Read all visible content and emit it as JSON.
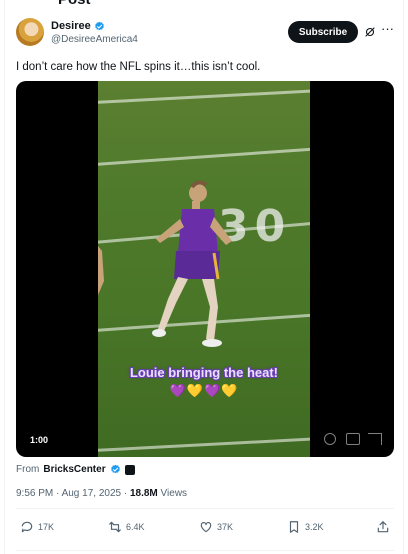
{
  "header": {
    "top_cut_text": "Post"
  },
  "tweet": {
    "author_name": "Desiree",
    "author_handle": "@DesireeAmerica4",
    "subscribe_label": "Subscribe",
    "text": "I don’t care how the NFL spins it…this isn’t cool.",
    "video": {
      "duration": "1:00",
      "caption": "Louie bringing the heat!",
      "emoji_line": "💜💛💜💛"
    },
    "source_prefix": "From",
    "source_name": "BricksCenter",
    "timestamp": "9:56 PM · Aug 17, 2025 ·",
    "views_count": "18.8M",
    "views_label": "Views",
    "actions": {
      "replies": "17K",
      "reposts": "6.4K",
      "likes": "37K",
      "bookmarks": "3.2K"
    }
  },
  "colors": {
    "verified_blue": "#1d9bf0",
    "text_primary": "#0f1419",
    "text_secondary": "#536471",
    "subscribe_bg": "#0f1419"
  },
  "icons": [
    "verified-badge-icon",
    "grok-icon",
    "more-icon",
    "reply-icon",
    "repost-icon",
    "like-icon",
    "bookmark-icon",
    "share-icon"
  ]
}
